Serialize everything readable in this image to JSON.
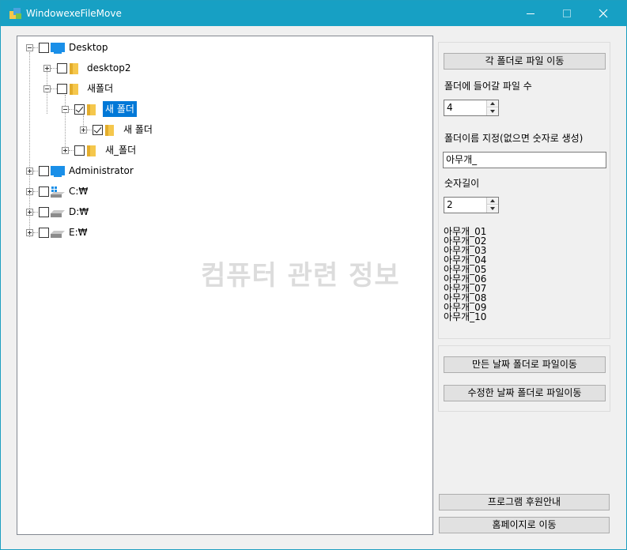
{
  "window": {
    "title": "WindowexeFileMove"
  },
  "tree": {
    "nodes": [
      {
        "label": "Desktop",
        "checked": false
      },
      {
        "label": "desktop2",
        "checked": false
      },
      {
        "label": "새폴더",
        "checked": false
      },
      {
        "label": "새 폴더",
        "checked": true,
        "selected": true
      },
      {
        "label": "새 폴더",
        "checked": true
      },
      {
        "label": "새_폴더",
        "checked": false
      },
      {
        "label": "Administrator",
        "checked": false
      },
      {
        "label": "C:₩",
        "checked": false
      },
      {
        "label": "D:₩",
        "checked": false
      },
      {
        "label": "E:₩",
        "checked": false
      }
    ],
    "watermark": "컴퓨터 관련 정보"
  },
  "panel1": {
    "move_button": "각 폴더로 파일 이동",
    "file_count_label": "폴더에 들어갈 파일 수",
    "file_count_value": "4",
    "folder_name_label": "폴더이름 지정(없으면 숫자로 생성)",
    "folder_name_value": "아무개_",
    "digits_label": "숫자길이",
    "digits_value": "2",
    "preview": [
      "아무개_01",
      "아무개_02",
      "아무개_03",
      "아무개_04",
      "아무개_05",
      "아무개_06",
      "아무개_07",
      "아무개_08",
      "아무개_09",
      "아무개_10"
    ]
  },
  "panel2": {
    "created_date_button": "만든 날짜 폴더로 파일이동",
    "modified_date_button": "수정한 날짜 폴더로 파일이동"
  },
  "footer": {
    "support_button": "프로그램 후원안내",
    "homepage_button": "홈페이지로 이동"
  },
  "colors": {
    "titlebar": "#17a0c4",
    "selection": "#0078d7",
    "folder": "#f5c74c",
    "desktop": "#1a8fe8"
  }
}
